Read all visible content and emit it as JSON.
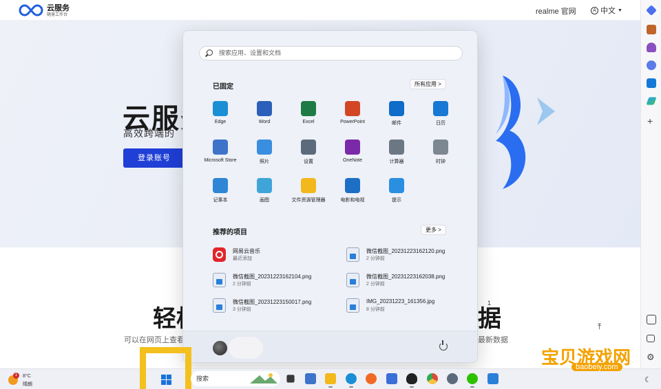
{
  "browser": {
    "logo_title": "云服务",
    "logo_subtitle": "随身工作台",
    "realme_link": "realme 官网",
    "language": "中文",
    "hero_title": "云服务",
    "hero_subtitle": "高效跨端的",
    "login_button": "登录账号",
    "lower_title_left": "轻松",
    "lower_title_right": "据",
    "lower_superscript": "1",
    "lower_sub_left": "可以在网页上查看",
    "lower_sub_right": "最新数据"
  },
  "start_menu": {
    "search_placeholder": "搜索应用、设置和文档",
    "pinned_title": "已固定",
    "all_apps_label": "所有应用  >",
    "pinned_apps": [
      {
        "label": "Edge",
        "icon": "edge-icon",
        "color": "#1b8fd6"
      },
      {
        "label": "Word",
        "icon": "word-icon",
        "color": "#2b5fb9"
      },
      {
        "label": "Excel",
        "icon": "excel-icon",
        "color": "#1e7b45"
      },
      {
        "label": "PowerPoint",
        "icon": "powerpoint-icon",
        "color": "#d24625"
      },
      {
        "label": "邮件",
        "icon": "mail-icon",
        "color": "#0f6cc8"
      },
      {
        "label": "日历",
        "icon": "calendar-icon",
        "color": "#1779d4"
      },
      {
        "label": "Microsoft Store",
        "icon": "store-icon",
        "color": "#3d73c9"
      },
      {
        "label": "照片",
        "icon": "photos-icon",
        "color": "#3a8ee0"
      },
      {
        "label": "设置",
        "icon": "settings-icon",
        "color": "#5b6b7c"
      },
      {
        "label": "OneNote",
        "icon": "onenote-icon",
        "color": "#7a2aa8"
      },
      {
        "label": "计算器",
        "icon": "calculator-icon",
        "color": "#6c7784"
      },
      {
        "label": "时钟",
        "icon": "clock-icon",
        "color": "#7d8792"
      },
      {
        "label": "记事本",
        "icon": "notepad-icon",
        "color": "#2f86d6"
      },
      {
        "label": "画图",
        "icon": "paint-icon",
        "color": "#3fa5d9"
      },
      {
        "label": "文件资源管理器",
        "icon": "folder-icon",
        "color": "#f2b81c"
      },
      {
        "label": "电影和电视",
        "icon": "movies-icon",
        "color": "#1d6fc4"
      },
      {
        "label": "提示",
        "icon": "tips-icon",
        "color": "#2a8fe0"
      }
    ],
    "recommended_title": "推荐的项目",
    "more_label": "更多  >",
    "recommended": [
      {
        "name": "网易云音乐",
        "time": "最近添加",
        "icon": "netease-music-icon",
        "color": "#e0262c"
      },
      {
        "name": "微信截图_20231223162120.png",
        "time": "2 分钟前",
        "icon": "image-file-icon",
        "color": "#e8eef8"
      },
      {
        "name": "微信截图_20231223162104.png",
        "time": "2 分钟前",
        "icon": "image-file-icon",
        "color": "#e8eef8"
      },
      {
        "name": "微信截图_20231223162038.png",
        "time": "2 分钟前",
        "icon": "image-file-icon",
        "color": "#e8eef8"
      },
      {
        "name": "微信截图_20231223150017.png",
        "time": "3 分钟前",
        "icon": "image-file-icon",
        "color": "#e8eef8"
      },
      {
        "name": "IMG_20231223_161356.jpg",
        "time": "8 分钟前",
        "icon": "image-file-icon",
        "color": "#e8eef8"
      }
    ]
  },
  "taskbar": {
    "weather_badge": "1",
    "temperature": "8°C",
    "weather_condition": "晴朗",
    "search_label": "搜索"
  },
  "watermark": {
    "text": "宝贝游戏网",
    "url": "baobeiy.com"
  }
}
